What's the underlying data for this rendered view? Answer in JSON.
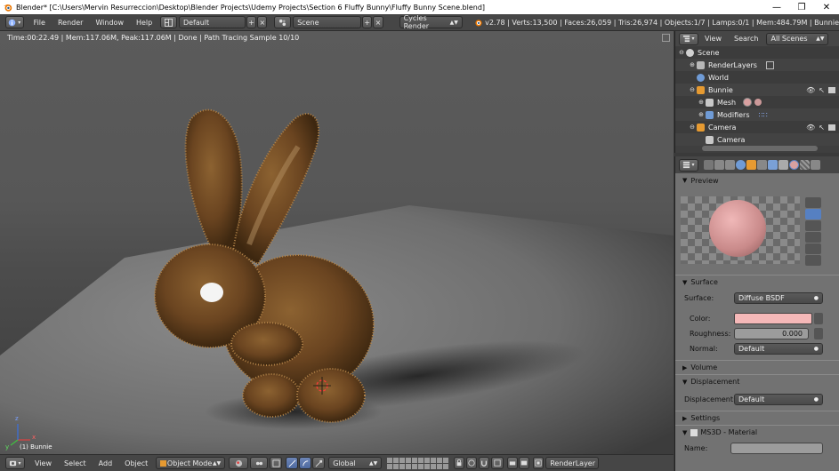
{
  "window": {
    "title": "Blender* [C:\\Users\\Mervin Resurreccion\\Desktop\\Blender Projects\\Udemy Projects\\Section 6 Fluffy Bunny\\Fluffy Bunny Scene.blend]",
    "minimize": "—",
    "maximize": "❐",
    "close": "✕"
  },
  "info_header": {
    "menus": [
      "File",
      "Render",
      "Window",
      "Help"
    ],
    "layout": "Default",
    "scene": "Scene",
    "engine": "Cycles Render",
    "stats": "v2.78 | Verts:13,500 | Faces:26,059 | Tris:26,974 | Objects:1/7 | Lamps:0/1 | Mem:484.79M | Bunnie"
  },
  "viewport": {
    "status": "Time:00:22.49 | Mem:117.06M, Peak:117.06M | Done | Path Tracing Sample 10/10",
    "object_label": "(1) Bunnie",
    "axis_x": "x",
    "axis_z": "z",
    "axis_y": "y"
  },
  "bottom_header": {
    "menus": [
      "View",
      "Select",
      "Add",
      "Object"
    ],
    "mode": "Object Mode",
    "orientation": "Global",
    "render_layer": "RenderLayer"
  },
  "outliner": {
    "menus": [
      "View",
      "Search"
    ],
    "filter": "All Scenes",
    "items": [
      {
        "label": "Scene",
        "indent": 0,
        "icon_color": "#d0d0d0"
      },
      {
        "label": "RenderLayers",
        "indent": 1,
        "icon_color": "#b8b8b8"
      },
      {
        "label": "World",
        "indent": 1,
        "icon_color": "#6f9bd6"
      },
      {
        "label": "Bunnie",
        "indent": 1,
        "icon_color": "#e69a31"
      },
      {
        "label": "Mesh",
        "indent": 2,
        "icon_color": "#c8c8c8"
      },
      {
        "label": "Modifiers",
        "indent": 2,
        "icon_color": "#6f9bd6"
      },
      {
        "label": "Camera",
        "indent": 1,
        "icon_color": "#e69a31"
      },
      {
        "label": "Camera",
        "indent": 2,
        "icon_color": "#c8c8c8"
      }
    ]
  },
  "properties": {
    "preview_title": "Preview",
    "surface_title": "Surface",
    "surface_label": "Surface:",
    "surface_value": "Diffuse BSDF",
    "color_label": "Color:",
    "color_value": "#f5b8b8",
    "roughness_label": "Roughness:",
    "roughness_value": "0.000",
    "normal_label": "Normal:",
    "normal_value": "Default",
    "volume_title": "Volume",
    "displacement_title": "Displacement",
    "displacement_label": "Displacement:",
    "displacement_value": "Default",
    "settings_title": "Settings",
    "ms3d_title": "MS3D - Material",
    "name_label": "Name:"
  }
}
